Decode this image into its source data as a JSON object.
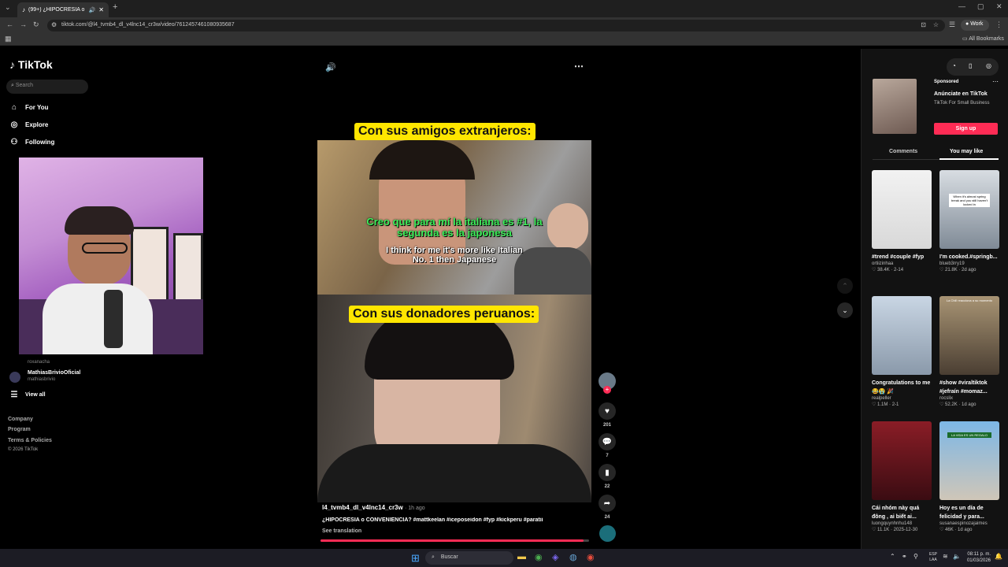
{
  "browser": {
    "tab_title": "(99+) ¿HIPOCRESÍA o CON",
    "url": "tiktok.com/@l4_tvmb4_dl_v4lnc14_cr3w/video/7612457461080935687",
    "profile": "Work",
    "bookmarks": "All Bookmarks"
  },
  "nav": {
    "logo": "TikTok",
    "search_placeholder": "Search",
    "items": [
      "For You",
      "Explore",
      "Following"
    ],
    "following_account": {
      "name": "MathiasBrivioOficial",
      "handle": "mathiasbrivio"
    },
    "partial_handle": "roxanacha",
    "view_all": "View all",
    "footer": [
      "Company",
      "Program",
      "Terms & Policies"
    ],
    "copyright": "© 2026 TikTok"
  },
  "video": {
    "top_label": "Con sus amigos extranjeros:",
    "sub_es": "Creo que para mí la italiana es #1, la segunda es la japonesa",
    "sub_en": "I think for me it's more like Italian No. 1 then Japanese",
    "bottom_label": "Con sus donadores peruanos:",
    "author": "l4_tvmb4_dl_v4lnc14_cr3w",
    "time": "1h ago",
    "caption": "¿HIPOCRESÍA o CONVENIENCIA? #mattkeelan #iceposeidon #fyp #kickperu #paratii",
    "see_translation": "See translation",
    "progress": 0.98
  },
  "actions": {
    "likes": "201",
    "comments": "7",
    "saves": "22",
    "shares": "24"
  },
  "sponsored": {
    "tag": "Sponsored",
    "title": "Anúnciate en TikTok",
    "subtitle": "TikTok For Small Business",
    "cta": "Sign up"
  },
  "tabs": {
    "comments": "Comments",
    "you_may_like": "You may like"
  },
  "cards": [
    {
      "t1": "#trend #couple #fyp",
      "user": "ortiizinhaa",
      "stats": "♡ 38.4K · 2-14",
      "overlay": ""
    },
    {
      "t1": "I'm cooked.#springb...",
      "user": "blueb3rry19",
      "stats": "♡ 21.8K · 2d ago",
      "overlay": "When it's almost spring break and you still haven't locked in"
    },
    {
      "t1": "Congratulations to me😂😭 🎉",
      "user": "realpeller",
      "stats": "♡ 1.1M · 2-1",
      "overlay": ""
    },
    {
      "t1": "#show #viraltiktok #jefraín #momaz...",
      "user": "rocslix",
      "stats": "♡ 52.2K · 1d ago",
      "overlay": "La Chill reacciona a su momento"
    },
    {
      "t1": "Cái nhóm này quá đông , ai biết ai...",
      "user": "luongquynhnhu148",
      "stats": "♡ 11.1K · 2025-12-30",
      "overlay": ""
    },
    {
      "t1": "Hoy es un día de felicidad y para...",
      "user": "susanaespinozajaimes",
      "stats": "♡ 46K · 1d ago",
      "overlay": "LA VIDA ES UN REGALO"
    }
  ],
  "taskbar": {
    "search": "Buscar",
    "lang": "ESP\nLAA",
    "time": "08:11 p. m.",
    "date": "01/03/2026"
  }
}
